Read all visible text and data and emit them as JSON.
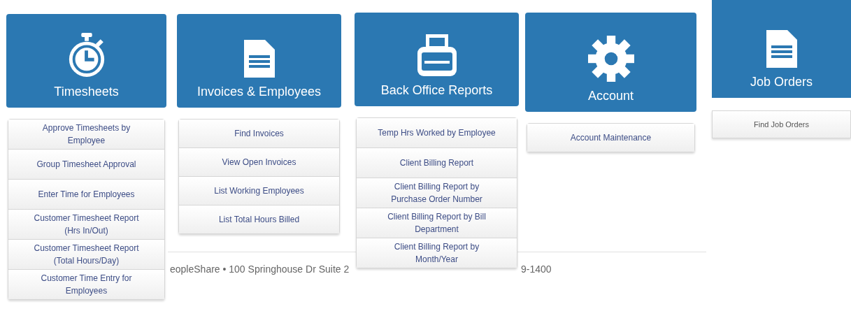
{
  "tiles": [
    {
      "title": "Timesheets",
      "kind": "stopwatch",
      "menu": [
        "Approve Timesheets by Employee",
        "Group Timesheet Approval",
        "Enter Time for Employees",
        "Customer Timesheet Report (Hrs In/Out)",
        "Customer Timesheet Report (Total Hours/Day)",
        "Customer Time Entry for Employees"
      ]
    },
    {
      "title": "Invoices & Employees",
      "kind": "document",
      "menu": [
        "Find Invoices",
        "View Open Invoices",
        "List Working Employees",
        "List Total Hours Billed"
      ]
    },
    {
      "title": "Back Office Reports",
      "kind": "printer",
      "menu": [
        "Temp Hrs Worked by Employee",
        "Client Billing Report",
        "Client Billing Report by Purchase Order Number",
        "Client Billing Report by Bill Department",
        "Client Billing Report by Month/Year"
      ]
    },
    {
      "title": "Account",
      "kind": "gear",
      "menu": [
        "Account Maintenance"
      ]
    },
    {
      "title": "Job Orders",
      "kind": "document",
      "menu": [
        "Find Job Orders"
      ]
    }
  ],
  "footer": [
    "eopleShare • 100 Springhouse Dr Suite 2",
    "9-1400"
  ]
}
